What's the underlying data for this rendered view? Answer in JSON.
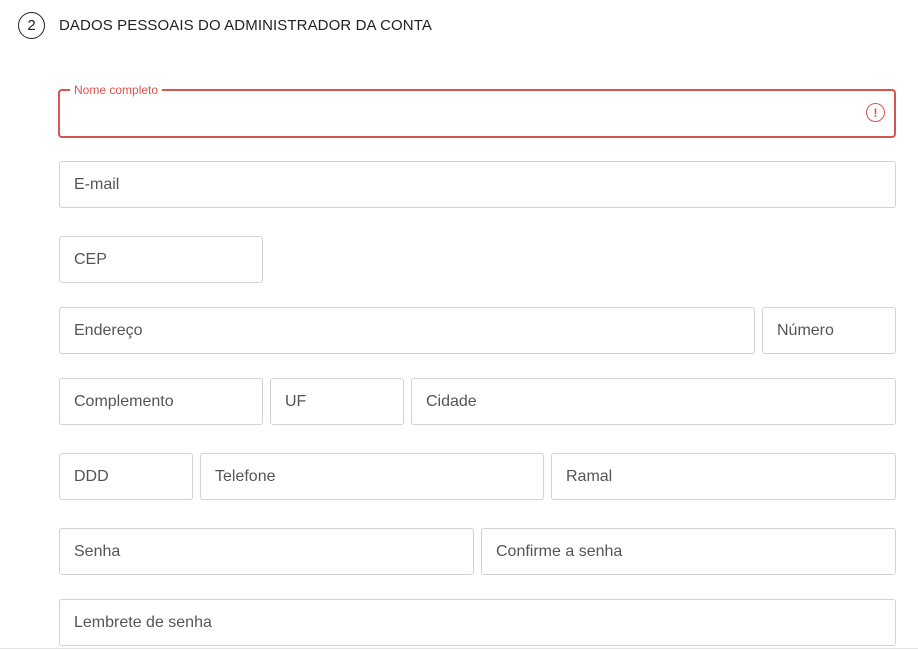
{
  "section": {
    "step_number": "2",
    "title": "DADOS PESSOAIS DO ADMINISTRADOR DA CONTA"
  },
  "form": {
    "nome_completo": {
      "label": "Nome completo",
      "value": "",
      "status": "error",
      "icon": "alert-circle-icon"
    },
    "email": {
      "placeholder": "E-mail"
    },
    "cep": {
      "placeholder": "CEP"
    },
    "endereco": {
      "placeholder": "Endereço"
    },
    "numero": {
      "placeholder": "Número"
    },
    "complemento": {
      "placeholder": "Complemento"
    },
    "uf": {
      "placeholder": "UF"
    },
    "cidade": {
      "placeholder": "Cidade"
    },
    "ddd": {
      "placeholder": "DDD"
    },
    "telefone": {
      "placeholder": "Telefone"
    },
    "ramal": {
      "placeholder": "Ramal"
    },
    "senha": {
      "placeholder": "Senha"
    },
    "confirme_senha": {
      "placeholder": "Confirme a senha"
    },
    "lembrete_senha": {
      "placeholder": "Lembrete de senha"
    }
  },
  "colors": {
    "error": "#d9534f",
    "border": "#d3d3d3",
    "text": "#555555"
  }
}
